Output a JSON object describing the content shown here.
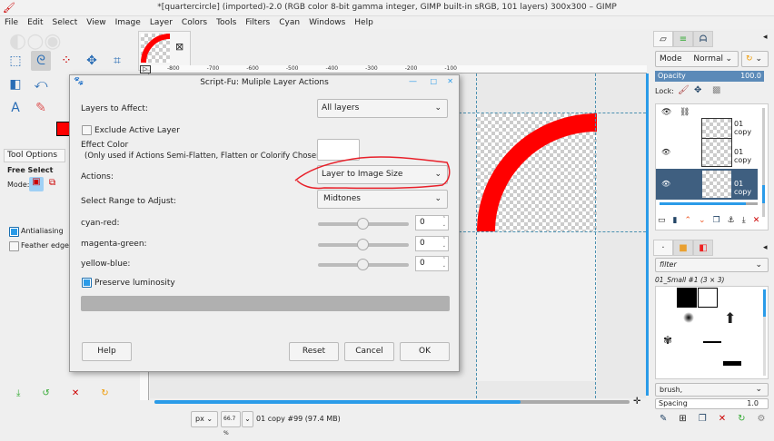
{
  "window": {
    "title": "*[quartercircle] (imported)-2.0 (RGB color 8-bit gamma integer, GIMP built-in sRGB, 101 layers) 300x300 – GIMP"
  },
  "menu": [
    "File",
    "Edit",
    "Select",
    "View",
    "Image",
    "Layer",
    "Colors",
    "Tools",
    "Filters",
    "Cyan",
    "Windows",
    "Help"
  ],
  "ruler": {
    "ticks": [
      "-800",
      "-700",
      "-600",
      "-500",
      "-400",
      "-300",
      "-200",
      "-100"
    ]
  },
  "tool_options": {
    "tab": "Tool Options",
    "tool": "Free Select",
    "mode_label": "Mode:",
    "antialiasing": "Antialiasing",
    "feather": "Feather edges"
  },
  "dialog": {
    "title": "Script-Fu: Muliple Layer Actions",
    "layers_label": "Layers to Affect:",
    "layers_value": "All layers",
    "exclude_label": "Exclude Active Layer",
    "effect_color_label": "Effect Color",
    "effect_color_note": "(Only used if Actions Semi-Flatten, Flatten or Colorify Chosen):",
    "actions_label": "Actions:",
    "actions_value": "Layer to Image Size",
    "range_label": "Select Range to Adjust:",
    "range_value": "Midtones",
    "sliders": [
      {
        "label": "cyan-red:",
        "value": "0"
      },
      {
        "label": "magenta-green:",
        "value": "0"
      },
      {
        "label": "yellow-blue:",
        "value": "0"
      }
    ],
    "preserve_label": "Preserve luminosity",
    "help": "Help",
    "reset": "Reset",
    "cancel": "Cancel",
    "ok": "OK"
  },
  "status": {
    "unit": "px",
    "zoom": "66.7 %",
    "info": "01 copy #99 (97.4 MB)"
  },
  "layers_panel": {
    "mode_label": "Mode",
    "mode_value": "Normal",
    "opacity_label": "Opacity",
    "opacity_value": "100.0",
    "lock_label": "Lock:",
    "layers": [
      "01 copy",
      "01 copy",
      "01 copy"
    ]
  },
  "brushes_panel": {
    "filter_placeholder": "filter",
    "brush_name": "01_Small #1 (3 × 3)",
    "tag_value": "brush,",
    "spacing_label": "Spacing",
    "spacing_value": "1.0"
  },
  "colors": {
    "accent": "#2a9be8",
    "foreground": "#ff0000",
    "annotation": "#e8202a",
    "selected_layer": "#3f5f80"
  }
}
